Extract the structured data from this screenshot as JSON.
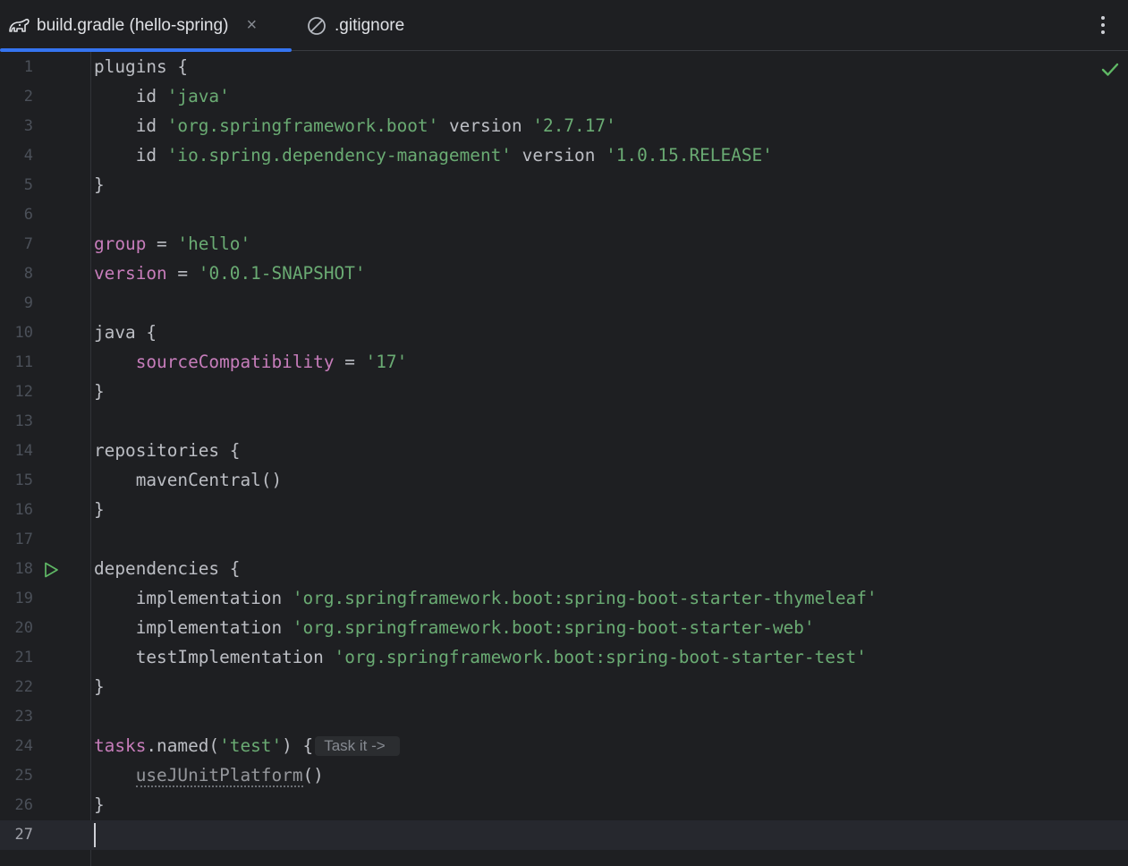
{
  "tabs": [
    {
      "label": "build.gradle (hello-spring)",
      "icon": "gradle-elephant-icon",
      "active": true,
      "close": "×"
    },
    {
      "label": ".gitignore",
      "icon": "ignored-file-icon",
      "active": false
    }
  ],
  "colors": {
    "background": "#1e1f22",
    "string": "#6aab73",
    "property": "#c77dbb",
    "text": "#bcbec4",
    "accent": "#3574f0",
    "ok": "#5fb865"
  },
  "editor": {
    "status_icon": "inspection-ok-check-icon",
    "current_line": 27,
    "run_gutter_line": 18,
    "lines": [
      {
        "n": "1",
        "tokens": [
          {
            "t": "plugins {",
            "c": "plain"
          }
        ]
      },
      {
        "n": "2",
        "tokens": [
          {
            "t": "    id ",
            "c": "plain"
          },
          {
            "t": "'java'",
            "c": "str"
          }
        ]
      },
      {
        "n": "3",
        "tokens": [
          {
            "t": "    id ",
            "c": "plain"
          },
          {
            "t": "'org.springframework.boot'",
            "c": "str"
          },
          {
            "t": " version ",
            "c": "plain"
          },
          {
            "t": "'2.7.17'",
            "c": "str"
          }
        ]
      },
      {
        "n": "4",
        "tokens": [
          {
            "t": "    id ",
            "c": "plain"
          },
          {
            "t": "'io.spring.dependency-management'",
            "c": "str"
          },
          {
            "t": " version ",
            "c": "plain"
          },
          {
            "t": "'1.0.15.RELEASE'",
            "c": "str"
          }
        ]
      },
      {
        "n": "5",
        "tokens": [
          {
            "t": "}",
            "c": "plain"
          }
        ]
      },
      {
        "n": "6",
        "tokens": []
      },
      {
        "n": "7",
        "tokens": [
          {
            "t": "group",
            "c": "prop"
          },
          {
            "t": " = ",
            "c": "plain"
          },
          {
            "t": "'hello'",
            "c": "str"
          }
        ]
      },
      {
        "n": "8",
        "tokens": [
          {
            "t": "version",
            "c": "prop"
          },
          {
            "t": " = ",
            "c": "plain"
          },
          {
            "t": "'0.0.1-SNAPSHOT'",
            "c": "str"
          }
        ]
      },
      {
        "n": "9",
        "tokens": []
      },
      {
        "n": "10",
        "tokens": [
          {
            "t": "java {",
            "c": "plain"
          }
        ]
      },
      {
        "n": "11",
        "tokens": [
          {
            "t": "    ",
            "c": "plain"
          },
          {
            "t": "sourceCompatibility",
            "c": "prop"
          },
          {
            "t": " = ",
            "c": "plain"
          },
          {
            "t": "'17'",
            "c": "str"
          }
        ]
      },
      {
        "n": "12",
        "tokens": [
          {
            "t": "}",
            "c": "plain"
          }
        ]
      },
      {
        "n": "13",
        "tokens": []
      },
      {
        "n": "14",
        "tokens": [
          {
            "t": "repositories {",
            "c": "plain"
          }
        ]
      },
      {
        "n": "15",
        "tokens": [
          {
            "t": "    mavenCentral()",
            "c": "plain"
          }
        ]
      },
      {
        "n": "16",
        "tokens": [
          {
            "t": "}",
            "c": "plain"
          }
        ]
      },
      {
        "n": "17",
        "tokens": []
      },
      {
        "n": "18",
        "tokens": [
          {
            "t": "dependencies {",
            "c": "plain"
          }
        ]
      },
      {
        "n": "19",
        "tokens": [
          {
            "t": "    implementation ",
            "c": "plain"
          },
          {
            "t": "'org.springframework.boot:spring-boot-starter-thymeleaf'",
            "c": "str"
          }
        ]
      },
      {
        "n": "20",
        "tokens": [
          {
            "t": "    implementation ",
            "c": "plain"
          },
          {
            "t": "'org.springframework.boot:spring-boot-starter-web'",
            "c": "str"
          }
        ]
      },
      {
        "n": "21",
        "tokens": [
          {
            "t": "    testImplementation ",
            "c": "plain"
          },
          {
            "t": "'org.springframework.boot:spring-boot-starter-test'",
            "c": "str"
          }
        ]
      },
      {
        "n": "22",
        "tokens": [
          {
            "t": "}",
            "c": "plain"
          }
        ]
      },
      {
        "n": "23",
        "tokens": []
      },
      {
        "n": "24",
        "tokens": [
          {
            "t": "tasks",
            "c": "prop"
          },
          {
            "t": ".named(",
            "c": "plain"
          },
          {
            "t": "'test'",
            "c": "str"
          },
          {
            "t": ") {",
            "c": "plain"
          }
        ],
        "hint": "Task it ->"
      },
      {
        "n": "25",
        "tokens": [
          {
            "t": "    ",
            "c": "plain"
          },
          {
            "t": "useJUnitPlatform",
            "c": "deprecated"
          },
          {
            "t": "()",
            "c": "plain"
          }
        ]
      },
      {
        "n": "26",
        "tokens": [
          {
            "t": "}",
            "c": "plain"
          }
        ]
      },
      {
        "n": "27",
        "tokens": []
      }
    ]
  }
}
